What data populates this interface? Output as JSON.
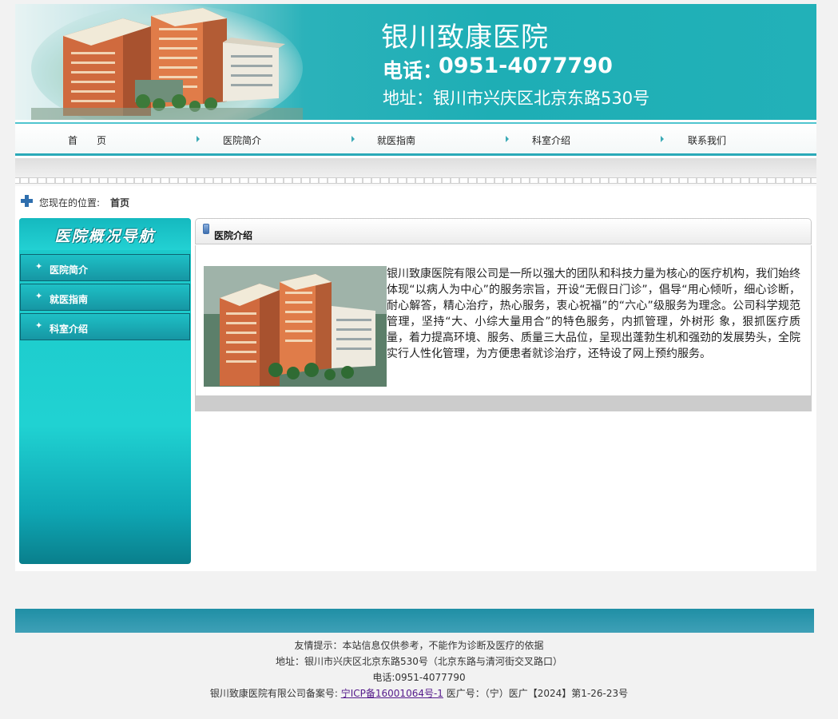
{
  "banner": {
    "title": "银川致康医院",
    "phone_label": "电话：",
    "phone": "0951-4077790",
    "address": "地址：银川市兴庆区北京东路530号"
  },
  "nav": {
    "items": [
      {
        "label": "首　　页"
      },
      {
        "label": "医院简介"
      },
      {
        "label": "就医指南"
      },
      {
        "label": "科室介绍"
      },
      {
        "label": "联系我们"
      }
    ]
  },
  "breadcrumb": {
    "label": "您现在的位置:",
    "current": "首页"
  },
  "sidebar": {
    "title": "医院概况导航",
    "items": [
      {
        "label": "医院简介"
      },
      {
        "label": "就医指南"
      },
      {
        "label": "科室介绍"
      }
    ]
  },
  "main": {
    "panel_title": "医院介绍",
    "body_text": "银川致康医院有限公司是一所以强大的团队和科技力量为核心的医疗机构，我们始终体现“以病人为中心”的服务宗旨，开设“无假日门诊”，倡导“用心倾听，细心诊断，耐心解答，精心治疗，热心服务，衷心祝福”的“六心”级服务为理念。公司科学规范管理，坚持“大、小综大量用合”的特色服务，内抓管理，外树形 象，狠抓医疗质量，着力提高环境、服务、质量三大品位，呈现出蓬勃生机和强劲的发展势头，全院实行人性化管理，为方便患者就诊治疗，还特设了网上预约服务。"
  },
  "footer": {
    "notice": "友情提示：本站信息仅供参考，不能作为诊断及医疗的依据",
    "address": "地址：银川市兴庆区北京东路530号（北京东路与清河街交叉路口）",
    "phone": "电话:0951-4077790",
    "record_prefix": "银川致康医院有限公司备案号:",
    "record_link": "宁ICP备16001064号-1",
    "ad_license": "医广号：（宁）医广【2024】第1-26-23号"
  }
}
